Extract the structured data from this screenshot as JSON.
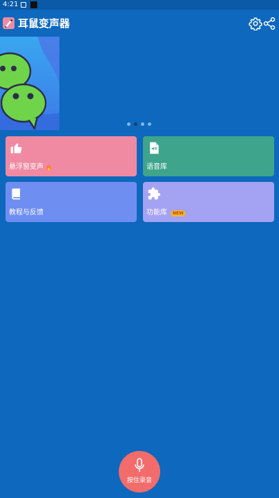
{
  "status_bar": {
    "time": "4:21"
  },
  "app_bar": {
    "title": "耳鼠变声器"
  },
  "banner": {
    "page_count": 4,
    "active_page": 2
  },
  "cards": [
    {
      "label": "悬浮窗变声",
      "icon": "thumbs-up-icon",
      "color": "#f08aa2",
      "badge_icon": "fire-icon"
    },
    {
      "label": "语音库",
      "icon": "audio-file-icon",
      "color": "#3ea48c"
    },
    {
      "label": "教程与反馈",
      "icon": "book-icon",
      "color": "#6f8ef2"
    },
    {
      "label": "功能库",
      "icon": "puzzle-icon",
      "color": "#a4a2f2",
      "badge": "NEW"
    }
  ],
  "record_button": {
    "label": "按住录音",
    "color": "#f36c6c"
  },
  "colors": {
    "background": "#0e68bd"
  }
}
